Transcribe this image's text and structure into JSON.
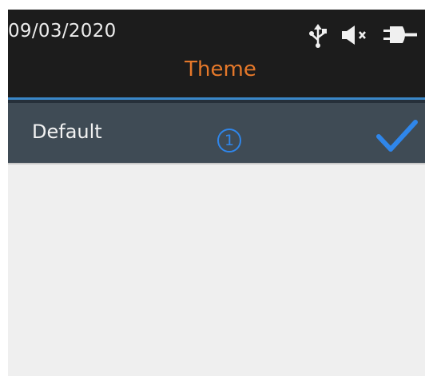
{
  "status_bar": {
    "date": "09/03/2020",
    "icons": [
      "usb-icon",
      "mute-icon",
      "power-plug-icon"
    ]
  },
  "header": {
    "title": "Theme"
  },
  "theme_list": {
    "items": [
      {
        "label": "Default",
        "badge": "1",
        "selected": true,
        "check_icon": "check-icon"
      }
    ]
  },
  "colors": {
    "title": "#e5782a",
    "accent": "#3a87c8",
    "selection": "#2f86ea",
    "status_bar_bg": "#1c1c1c",
    "selected_row_bg": "#3f4b55",
    "content_bg": "#efefef"
  }
}
